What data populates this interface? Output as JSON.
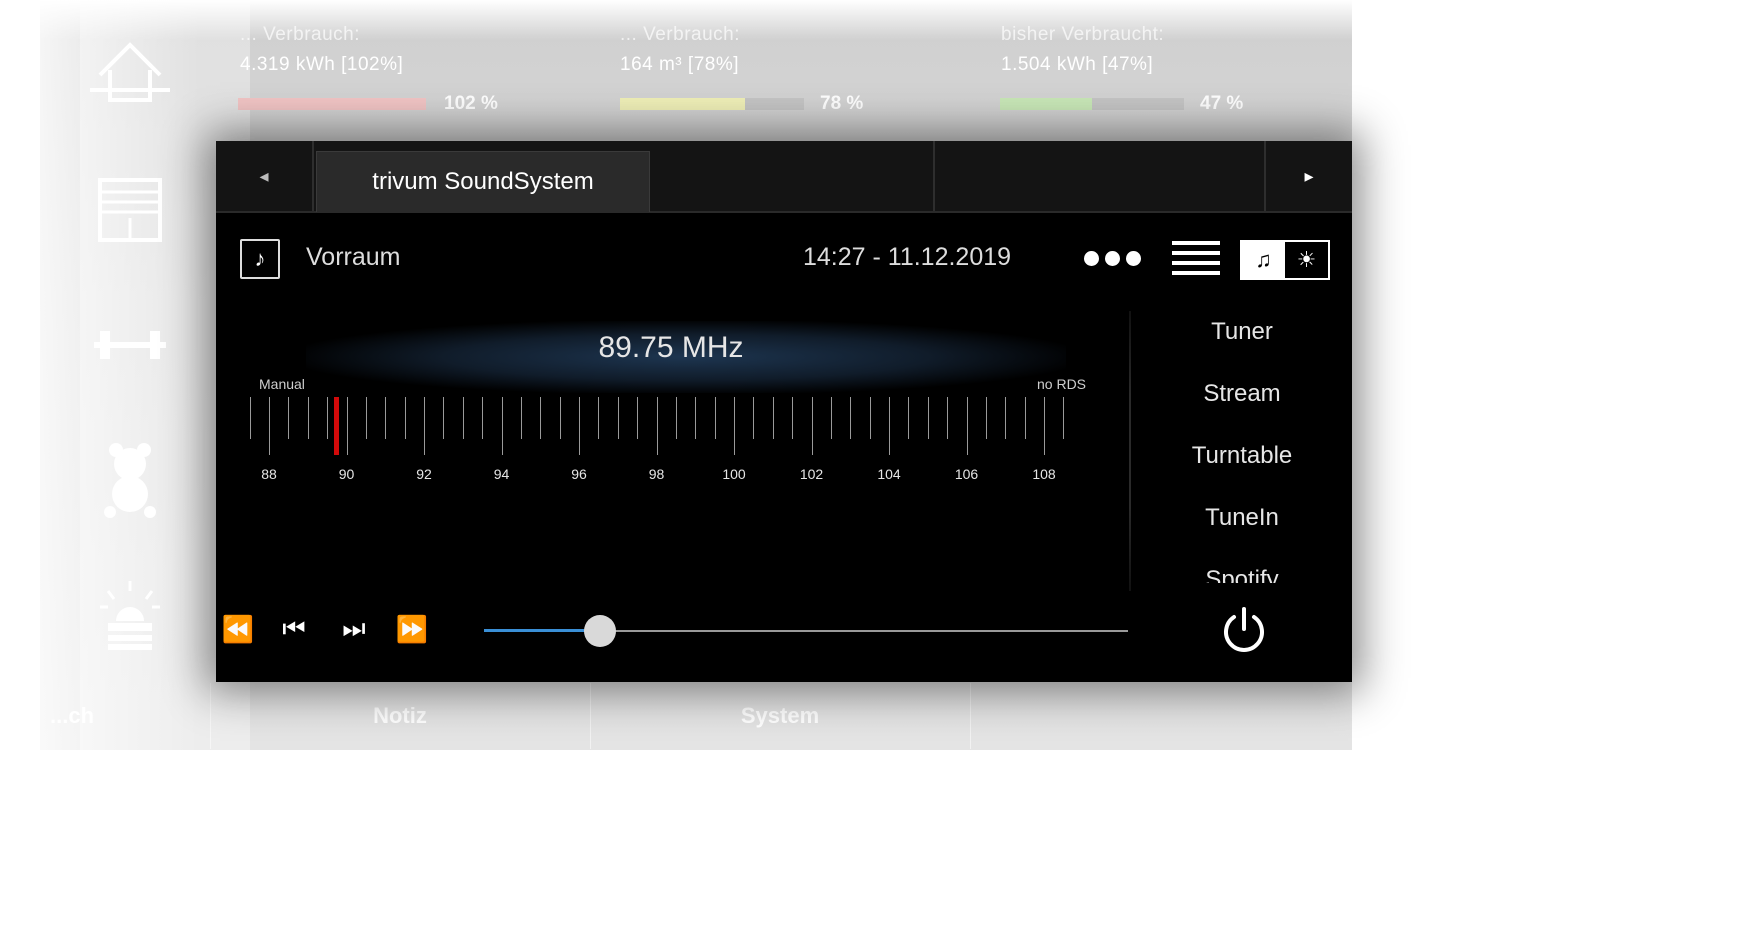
{
  "background": {
    "stats": [
      {
        "label": "... Verbrauch:",
        "value": "4.319 kWh [102%]",
        "percent_text": "102 %",
        "level": 1.0,
        "color": "#f2c5c5"
      },
      {
        "label": "... Verbrauch:",
        "value": "164 m³ [78%]",
        "percent_text": "78 %",
        "level": 0.68,
        "color": "#f0f0b8"
      },
      {
        "label": "bisher Verbraucht:",
        "value": "1.504 kWh [47%]",
        "percent_text": "47 %",
        "level": 0.5,
        "color": "#c9e8b8"
      }
    ],
    "bottom_tabs": [
      "...ch",
      "Notiz",
      "System"
    ],
    "side_icons": [
      "house-icon",
      "window-blind-icon",
      "dumbbell-icon",
      "teddy-bear-icon",
      "alarm-light-icon"
    ]
  },
  "panel": {
    "tabs": {
      "prev_icon": "◂",
      "next_icon": "▸",
      "active_label": "trivum SoundSystem",
      "other_labels": [
        "",
        ""
      ]
    },
    "header": {
      "room_icon": "♪",
      "room_name": "Vorraum",
      "datetime": "14:27 - 11.12.2019",
      "mode_music_icon": "♫",
      "mode_light_icon": "☀"
    },
    "tuner": {
      "frequency": "89.75 MHz",
      "mode_label": "Manual",
      "rds_label": "no RDS",
      "current_mhz": 89.75
    },
    "sources": [
      "Tuner",
      "Stream",
      "Turntable",
      "TuneIn",
      "Spotify"
    ],
    "controls": {
      "rewind_icon": "⏪",
      "prev_icon": "⏮",
      "next_icon": "⏭",
      "forward_icon": "⏩",
      "volume_level": 0.18
    }
  },
  "chart_data": {
    "type": "scale",
    "x_ticks": [
      88,
      90,
      92,
      94,
      96,
      98,
      100,
      102,
      104,
      106,
      108
    ],
    "xlim": [
      87.5,
      108.5
    ],
    "minor_step": 0.5,
    "marker": 89.75
  }
}
